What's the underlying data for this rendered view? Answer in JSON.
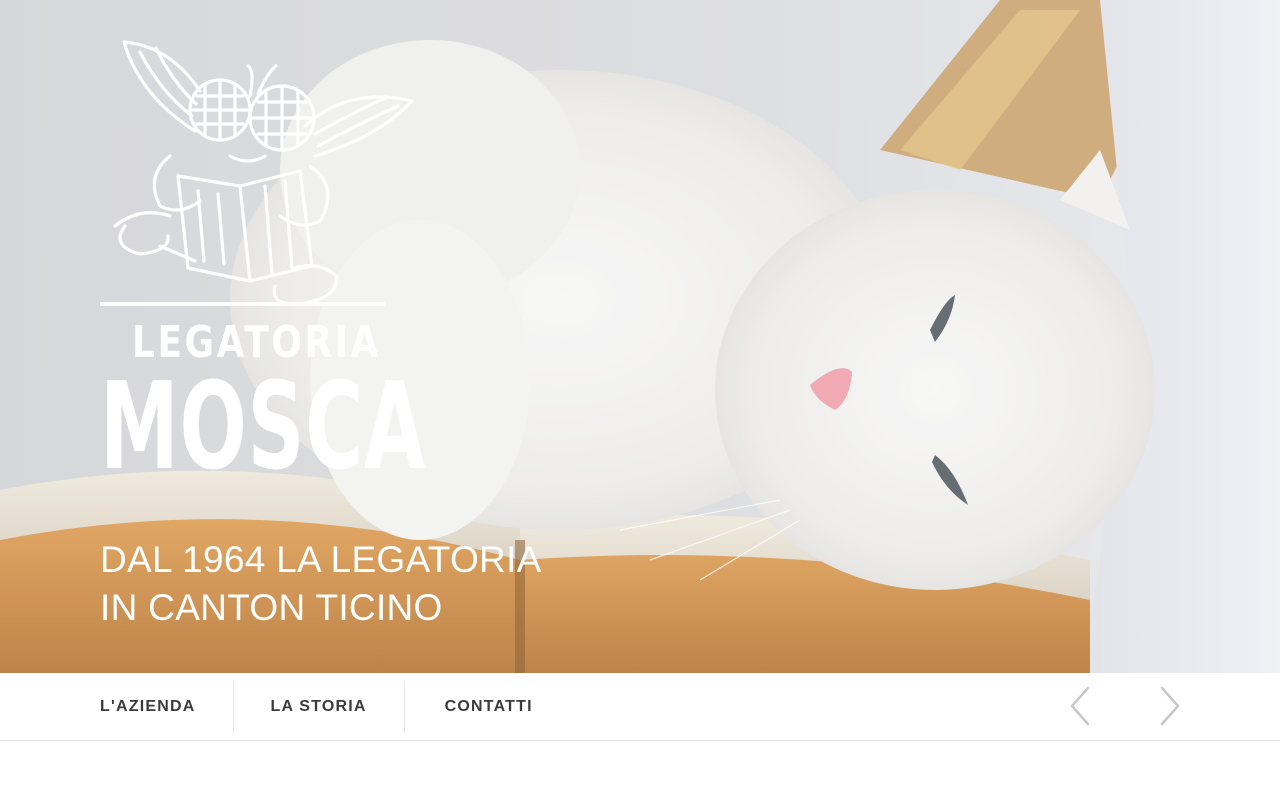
{
  "brand": {
    "name_top": "LEGATORIA",
    "name_main": "MOSCA"
  },
  "hero": {
    "tagline_line1": "DAL 1964 LA LEGATORIA",
    "tagline_line2": "IN CANTON TICINO"
  },
  "nav": {
    "items": [
      {
        "label": "L'AZIENDA"
      },
      {
        "label": "LA STORIA"
      },
      {
        "label": "CONTATTI"
      }
    ]
  },
  "slider": {
    "prev_icon": "chevron-left-icon",
    "next_icon": "chevron-right-icon"
  },
  "colors": {
    "logo": "#ffffff",
    "nav_text": "#3b3b3b",
    "arrow": "#c8c8c8",
    "divider": "#e8e8e8"
  }
}
